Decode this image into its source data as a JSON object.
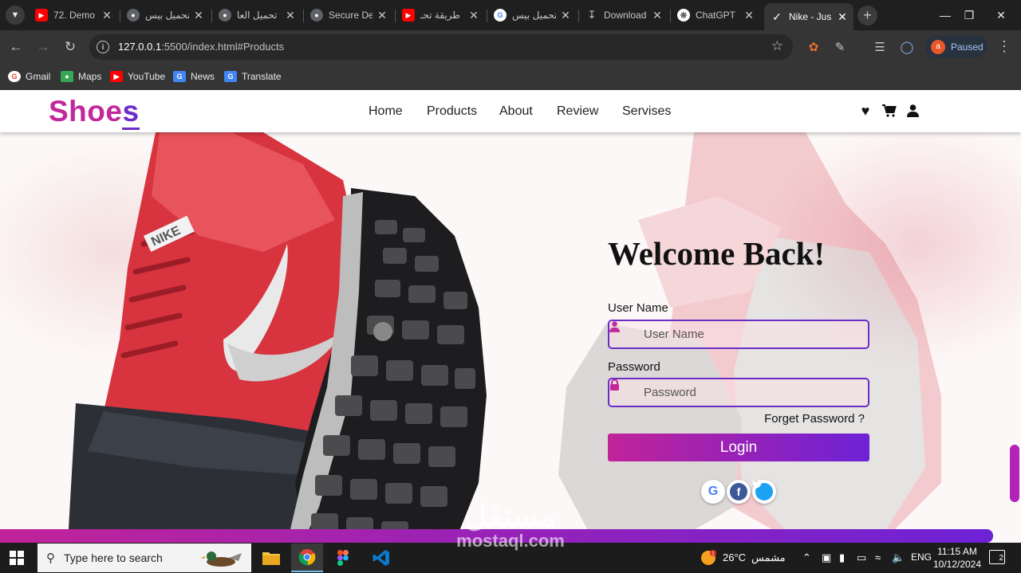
{
  "browser": {
    "tabs": [
      {
        "label": "72. Demo",
        "icon": "youtube-icon",
        "color": "#ff0000"
      },
      {
        "label": "تحميل بيس",
        "icon": "android-icon",
        "color": "#5f6368"
      },
      {
        "label": "تحميل العا",
        "icon": "android-icon",
        "color": "#5f6368"
      },
      {
        "label": "Secure De",
        "icon": "globe-icon",
        "color": "#5f6368"
      },
      {
        "label": "طريقة تحـ",
        "icon": "youtube-icon",
        "color": "#ff0000"
      },
      {
        "label": "تحميل بيس",
        "icon": "google-icon",
        "color": "#ffffff"
      },
      {
        "label": "Download",
        "icon": "download-icon",
        "color": "#5f6368"
      },
      {
        "label": "ChatGPT",
        "icon": "chatgpt-icon",
        "color": "#5f6368"
      },
      {
        "label": "Nike - Jus",
        "icon": "nike-icon",
        "color": "#ffffff"
      }
    ],
    "url_host": "127.0.0.1",
    "url_rest": ":5500/index.html#Products",
    "profile_initial": "a",
    "profile_status": "Paused",
    "bookmarks": [
      {
        "label": "Gmail",
        "icon": "gmail-icon",
        "color": "#ea4335"
      },
      {
        "label": "Maps",
        "icon": "maps-icon",
        "color": "#34a853"
      },
      {
        "label": "YouTube",
        "icon": "youtube-icon",
        "color": "#ff0000"
      },
      {
        "label": "News",
        "icon": "news-icon",
        "color": "#4285f4"
      },
      {
        "label": "Translate",
        "icon": "translate-icon",
        "color": "#4285f4"
      }
    ]
  },
  "site": {
    "logo_main": "Shoe",
    "logo_last": "s",
    "nav": [
      "Home",
      "Products",
      "About",
      "Review",
      "Servises"
    ],
    "brand_colors": {
      "pink": "#c2289a",
      "purple": "#6c2dc7"
    }
  },
  "login": {
    "title": "Welcome Back!",
    "username_label": "User Name",
    "username_placeholder": "User Name",
    "password_label": "Password",
    "password_placeholder": "Password",
    "forget": "Forget Password ?",
    "button": "Login",
    "social": [
      "google-icon",
      "facebook-icon",
      "twitter-icon"
    ]
  },
  "watermark": {
    "arabic": "مستقل",
    "latin": "mostaql.com"
  },
  "taskbar": {
    "search_placeholder": "Type here to search",
    "temperature": "26°C",
    "weather": "مشمس",
    "language": "ENG",
    "time": "11:15 AM",
    "date": "10/12/2024",
    "notifications": "2"
  }
}
